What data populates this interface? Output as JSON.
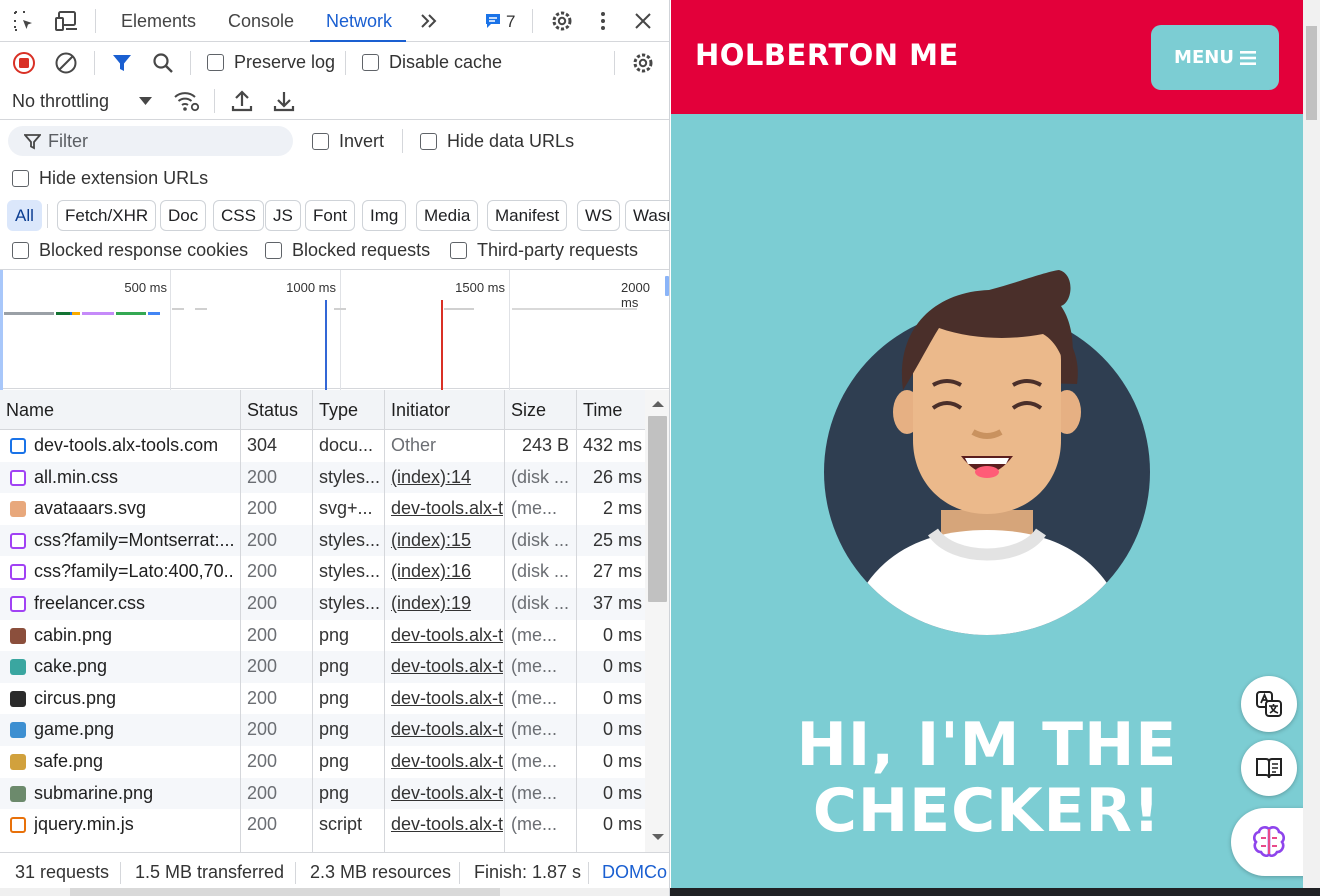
{
  "devtools": {
    "tabs": [
      "Elements",
      "Console",
      "Network"
    ],
    "active_tab": "Network",
    "issues_count": "7",
    "toolbar": {
      "preserve_log": "Preserve log",
      "disable_cache": "Disable cache",
      "throttling": "No throttling"
    },
    "filter": {
      "placeholder": "Filter",
      "invert": "Invert",
      "hide_data_urls": "Hide data URLs",
      "hide_extension_urls": "Hide extension URLs"
    },
    "type_filters": [
      "All",
      "Fetch/XHR",
      "Doc",
      "CSS",
      "JS",
      "Font",
      "Img",
      "Media",
      "Manifest",
      "WS",
      "Wasm"
    ],
    "active_type_filter": "All",
    "blocked": {
      "blocked_cookies": "Blocked response cookies",
      "blocked_requests": "Blocked requests",
      "third_party": "Third-party requests"
    },
    "timeline_ticks": [
      "500 ms",
      "1000 ms",
      "1500 ms",
      "2000 ms"
    ],
    "columns": [
      "Name",
      "Status",
      "Type",
      "Initiator",
      "Size",
      "Time"
    ],
    "requests": [
      {
        "name": "dev-tools.alx-tools.com",
        "status": "304",
        "type": "docu...",
        "initiator": "Other",
        "size": "243 B",
        "time": "432 ms",
        "icon": "document-icon",
        "color": "#1a73e8"
      },
      {
        "name": "all.min.css",
        "status": "200",
        "type": "styles...",
        "initiator": "(index):14",
        "size": "(disk ...",
        "time": "26 ms",
        "icon": "stylesheet-icon",
        "color": "#a142f4"
      },
      {
        "name": "avataaars.svg",
        "status": "200",
        "type": "svg+...",
        "initiator": "dev-tools.alx-t",
        "size": "(me...",
        "time": "2 ms",
        "icon": "avatar-image-icon",
        "color": "#e8a87c"
      },
      {
        "name": "css?family=Montserrat:...",
        "status": "200",
        "type": "styles...",
        "initiator": "(index):15",
        "size": "(disk ...",
        "time": "25 ms",
        "icon": "stylesheet-icon",
        "color": "#a142f4"
      },
      {
        "name": "css?family=Lato:400,70...",
        "status": "200",
        "type": "styles...",
        "initiator": "(index):16",
        "size": "(disk ...",
        "time": "27 ms",
        "icon": "stylesheet-icon",
        "color": "#a142f4"
      },
      {
        "name": "freelancer.css",
        "status": "200",
        "type": "styles...",
        "initiator": "(index):19",
        "size": "(disk ...",
        "time": "37 ms",
        "icon": "stylesheet-icon",
        "color": "#a142f4"
      },
      {
        "name": "cabin.png",
        "status": "200",
        "type": "png",
        "initiator": "dev-tools.alx-t",
        "size": "(me...",
        "time": "0 ms",
        "icon": "png-thumbnail-icon",
        "color": "#8b4f3c"
      },
      {
        "name": "cake.png",
        "status": "200",
        "type": "png",
        "initiator": "dev-tools.alx-t",
        "size": "(me...",
        "time": "0 ms",
        "icon": "png-thumbnail-icon",
        "color": "#3aa6a0"
      },
      {
        "name": "circus.png",
        "status": "200",
        "type": "png",
        "initiator": "dev-tools.alx-t",
        "size": "(me...",
        "time": "0 ms",
        "icon": "png-thumbnail-icon",
        "color": "#2b2b2b"
      },
      {
        "name": "game.png",
        "status": "200",
        "type": "png",
        "initiator": "dev-tools.alx-t",
        "size": "(me...",
        "time": "0 ms",
        "icon": "png-thumbnail-icon",
        "color": "#3d8fd1"
      },
      {
        "name": "safe.png",
        "status": "200",
        "type": "png",
        "initiator": "dev-tools.alx-t",
        "size": "(me...",
        "time": "0 ms",
        "icon": "png-thumbnail-icon",
        "color": "#d1a13d"
      },
      {
        "name": "submarine.png",
        "status": "200",
        "type": "png",
        "initiator": "dev-tools.alx-t",
        "size": "(me...",
        "time": "0 ms",
        "icon": "png-thumbnail-icon",
        "color": "#6c8a6c"
      },
      {
        "name": "jquery.min.js",
        "status": "200",
        "type": "script",
        "initiator": "dev-tools.alx-t",
        "size": "(me...",
        "time": "0 ms",
        "icon": "script-icon",
        "color": "#e8710a"
      }
    ],
    "summary": {
      "requests": "31 requests",
      "transferred": "1.5 MB transferred",
      "resources": "2.3 MB resources",
      "finish": "Finish: 1.87 s",
      "domcontent": "DOMCo"
    }
  },
  "page": {
    "brand": "HOLBERTON ME",
    "menu_label": "MENU",
    "hero_line1": "HI, I'M THE",
    "hero_line2": "CHECKER!",
    "navbar_color": "#e3003a",
    "background_color": "#7ccdd3"
  }
}
